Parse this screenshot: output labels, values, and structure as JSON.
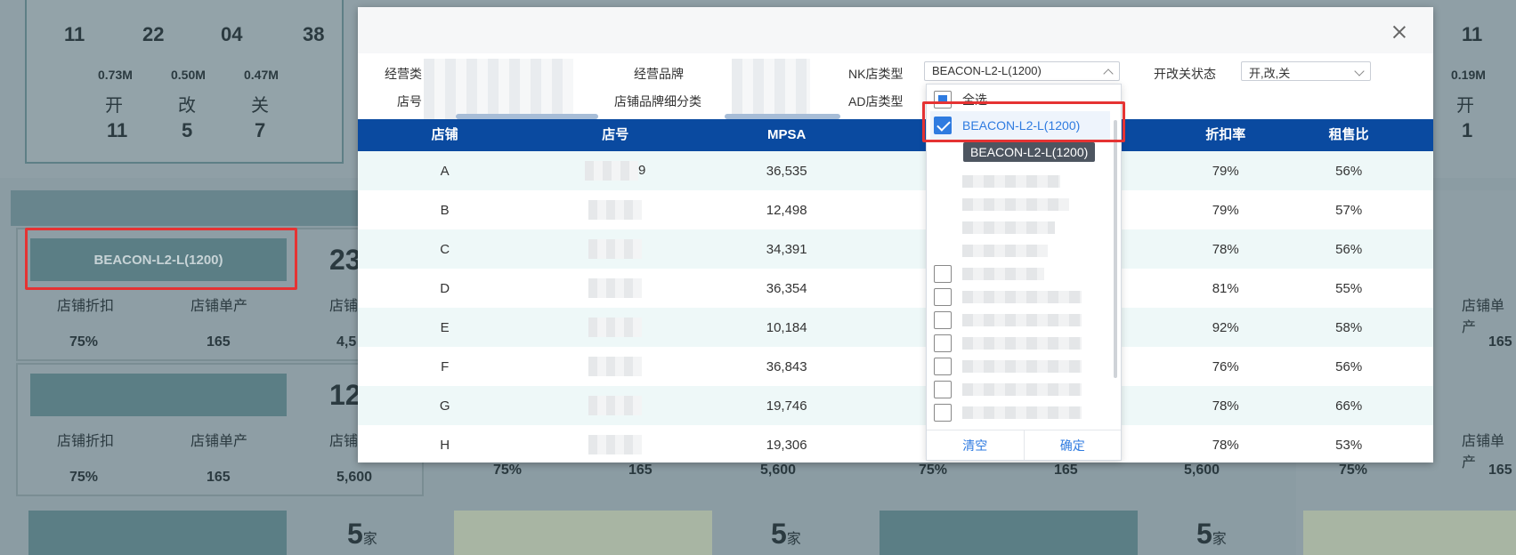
{
  "background": {
    "top_numbers": [
      "11",
      "22",
      "04",
      "38"
    ],
    "top_right_number": "11",
    "mini_values": [
      "0.73M",
      "0.50M",
      "0.47M"
    ],
    "mini_right_value": "0.19M",
    "status_labels": [
      "开",
      "改",
      "关"
    ],
    "status_counts": [
      "11",
      "5",
      "7"
    ],
    "right_status_label": "开",
    "right_status_count": "1",
    "card1": {
      "brand": "BEACON-L2-L(1200)",
      "count": "23",
      "label_discount": "店铺折扣",
      "label_output": "店铺单产",
      "label_third": "店铺",
      "discount": "75%",
      "output": "165",
      "third_value": "4,5"
    },
    "card2": {
      "count": "12",
      "label_discount": "店铺折扣",
      "label_output": "店铺单产",
      "label_third": "店铺",
      "discount": "75%",
      "output": "165",
      "third_value": "5,600"
    },
    "card_right_label": "店铺单产",
    "card_right_value": "165",
    "bottom_row": [
      {
        "a": "75%",
        "b": "165",
        "c": "5,600"
      },
      {
        "a": "75%",
        "b": "165",
        "c": "5,600"
      },
      {
        "a": "75%",
        "b": "165"
      }
    ],
    "bottom_counts": [
      "5",
      "5",
      "5"
    ],
    "jia": "家"
  },
  "modal": {
    "filters": {
      "business_type_label": "经营类",
      "store_no_label": "店号",
      "brand_label": "经营品牌",
      "brand_sub_label": "店铺品牌细分类",
      "nk_type_label": "NK店类型",
      "nk_type_value": "BEACON-L2-L(1200)",
      "ad_type_label": "AD店类型",
      "status_label": "开改关状态",
      "status_value": "开,改,关"
    },
    "table": {
      "headers": [
        "店铺",
        "店号",
        "MPSA",
        "",
        "折扣率",
        "租售比"
      ],
      "rows": [
        {
          "shop": "A",
          "store_no": "9",
          "mpsa": "36,535",
          "discount": "79%",
          "rent_ratio": "56%"
        },
        {
          "shop": "B",
          "store_no": "",
          "mpsa": "12,498",
          "discount": "79%",
          "rent_ratio": "57%"
        },
        {
          "shop": "C",
          "store_no": "",
          "mpsa": "34,391",
          "discount": "78%",
          "rent_ratio": "56%"
        },
        {
          "shop": "D",
          "store_no": "",
          "mpsa": "36,354",
          "discount": "81%",
          "rent_ratio": "55%"
        },
        {
          "shop": "E",
          "store_no": "",
          "mpsa": "10,184",
          "discount": "92%",
          "rent_ratio": "58%"
        },
        {
          "shop": "F",
          "store_no": "",
          "mpsa": "36,843",
          "discount": "76%",
          "rent_ratio": "56%"
        },
        {
          "shop": "G",
          "store_no": "",
          "mpsa": "19,746",
          "discount": "78%",
          "rent_ratio": "66%"
        },
        {
          "shop": "H",
          "store_no": "",
          "mpsa": "19,306",
          "discount": "78%",
          "rent_ratio": "53%"
        }
      ]
    },
    "dropdown": {
      "select_all": "全选",
      "selected_item": "BEACON-L2-L(1200)",
      "tooltip": "BEACON-L2-L(1200)",
      "clear": "清空",
      "confirm": "确定"
    }
  },
  "colors": {
    "header_blue": "#0a4aa0",
    "checkbox_blue": "#2f7be0",
    "highlight_red": "#e53333"
  }
}
